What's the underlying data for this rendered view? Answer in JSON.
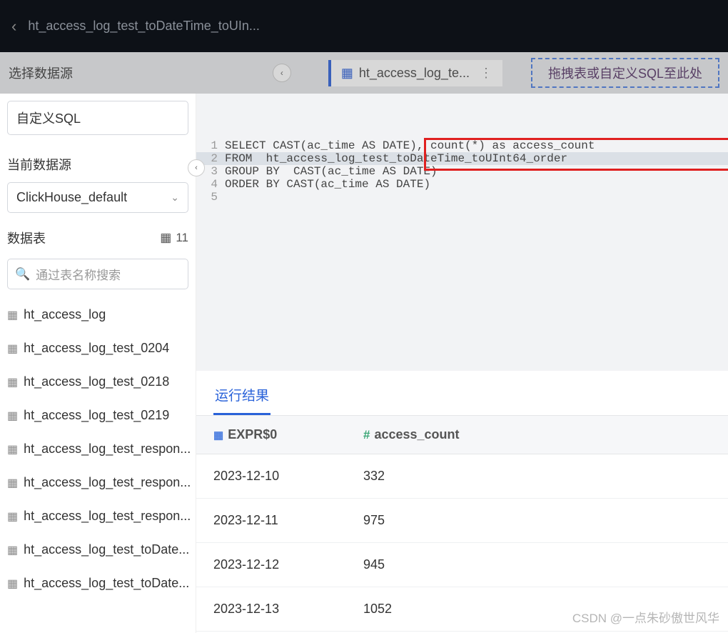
{
  "header": {
    "title": "ht_access_log_test_toDateTime_toUIn..."
  },
  "secondary": {
    "select_ds_label": "选择数据源",
    "tab_label": "ht_access_log_te...",
    "drop_hint": "拖拽表或自定义SQL至此处"
  },
  "sidebar": {
    "custom_sql_label": "自定义SQL",
    "current_ds_label": "当前数据源",
    "ds_selected": "ClickHouse_default",
    "tables_label": "数据表",
    "table_count": "11",
    "search_placeholder": "通过表名称搜索",
    "tables": [
      "ht_access_log",
      "ht_access_log_test_0204",
      "ht_access_log_test_0218",
      "ht_access_log_test_0219",
      "ht_access_log_test_respon...",
      "ht_access_log_test_respon...",
      "ht_access_log_test_respon...",
      "ht_access_log_test_toDate...",
      "ht_access_log_test_toDate..."
    ]
  },
  "editor": {
    "lines": [
      "SELECT CAST(ac_time AS DATE), count(*) as access_count",
      "FROM  ht_access_log_test_toDateTime_toUInt64_order",
      "GROUP BY  CAST(ac_time AS DATE)",
      "ORDER BY CAST(ac_time AS DATE)",
      ""
    ]
  },
  "results": {
    "tab_label": "运行结果",
    "columns": [
      "EXPR$0",
      "access_count"
    ],
    "rows": [
      [
        "2023-12-10",
        "332"
      ],
      [
        "2023-12-11",
        "975"
      ],
      [
        "2023-12-12",
        "945"
      ],
      [
        "2023-12-13",
        "1052"
      ]
    ]
  },
  "watermark": "CSDN @一点朱砂傲世风华"
}
